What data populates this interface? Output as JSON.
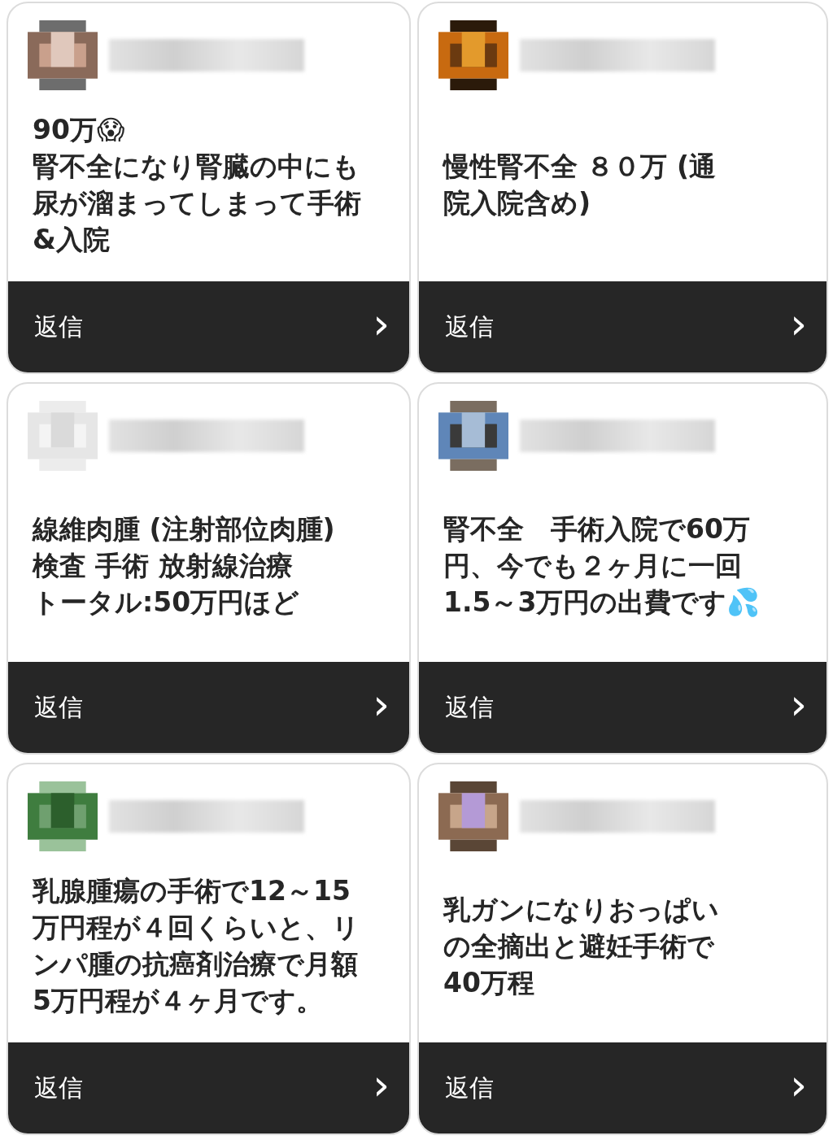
{
  "replies": [
    {
      "avatar": {
        "kind": "picture"
      },
      "lines": [
        "90万😱",
        "腎不全になり腎臓の中にも",
        "尿が溜まってしまって手術",
        "&入院"
      ],
      "reply_label": "返信",
      "chevron": "›"
    },
    {
      "avatar": {
        "kind": "picture"
      },
      "lines": [
        "慢性腎不全 ８０万 (通",
        "院入院含め)"
      ],
      "reply_label": "返信",
      "chevron": "›"
    },
    {
      "avatar": {
        "kind": "picture"
      },
      "lines": [
        "線維肉腫 (注射部位肉腫)",
        "検査 手術 放射線治療",
        "トータル:50万円ほど"
      ],
      "reply_label": "返信",
      "chevron": "›"
    },
    {
      "avatar": {
        "kind": "picture"
      },
      "lines": [
        "腎不全　手術入院で60万",
        "円、今でも２ヶ月に一回",
        "1.5～3万円の出費です💦"
      ],
      "reply_label": "返信",
      "chevron": "›"
    },
    {
      "avatar": {
        "kind": "picture"
      },
      "lines": [
        "乳腺腫瘍の手術で12～15",
        "万円程が４回くらいと、リ",
        "ンパ腫の抗癌剤治療で月額",
        "5万円程が４ヶ月です。"
      ],
      "reply_label": "返信",
      "chevron": "›"
    },
    {
      "avatar": {
        "kind": "picture"
      },
      "lines": [
        "乳ガンになりおっぱい",
        "の全摘出と避妊手術で",
        "40万程"
      ],
      "reply_label": "返信",
      "chevron": "›"
    }
  ]
}
